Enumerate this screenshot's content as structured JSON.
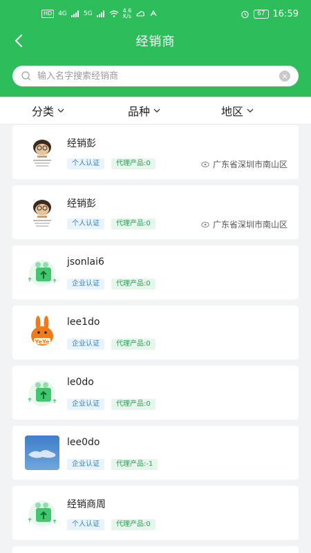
{
  "status_bar": {
    "hd": "HD",
    "net1": "4G",
    "net2": "5G",
    "speed_value": "4.6",
    "speed_unit": "K/s",
    "battery": "67",
    "time": "16:59"
  },
  "nav": {
    "title": "经销商"
  },
  "search": {
    "placeholder": "输入名字搜索经销商"
  },
  "filters": [
    {
      "label": "分类"
    },
    {
      "label": "品种"
    },
    {
      "label": "地区"
    }
  ],
  "dealers": [
    {
      "name": "经销彭",
      "cert": "个人认证",
      "products": "代理产品:0",
      "location": "广东省深圳市南山区",
      "avatar": "cartoon-avatar"
    },
    {
      "name": "经销彭",
      "cert": "个人认证",
      "products": "代理产品:0",
      "location": "广东省深圳市南山区",
      "avatar": "cartoon-avatar"
    },
    {
      "name": "jsonlai6",
      "cert": "企业认证",
      "products": "代理产品:0",
      "location": "",
      "avatar": "upload-placeholder"
    },
    {
      "name": "lee1do",
      "cert": "企业认证",
      "products": "代理产品:0",
      "location": "",
      "avatar": "yeye-rabbit"
    },
    {
      "name": "le0do",
      "cert": "企业认证",
      "products": "代理产品:0",
      "location": "",
      "avatar": "upload-placeholder"
    },
    {
      "name": "lee0do",
      "cert": "企业认证",
      "products": "代理产品:-1",
      "location": "",
      "avatar": "sky-photo"
    },
    {
      "name": "经销商周",
      "cert": "个人认证",
      "products": "代理产品:0",
      "location": "",
      "avatar": "upload-placeholder"
    }
  ],
  "colors": {
    "brand": "#2dbd5a",
    "cert_tag": "#3b7fb0",
    "agent_tag": "#2f9a55"
  }
}
